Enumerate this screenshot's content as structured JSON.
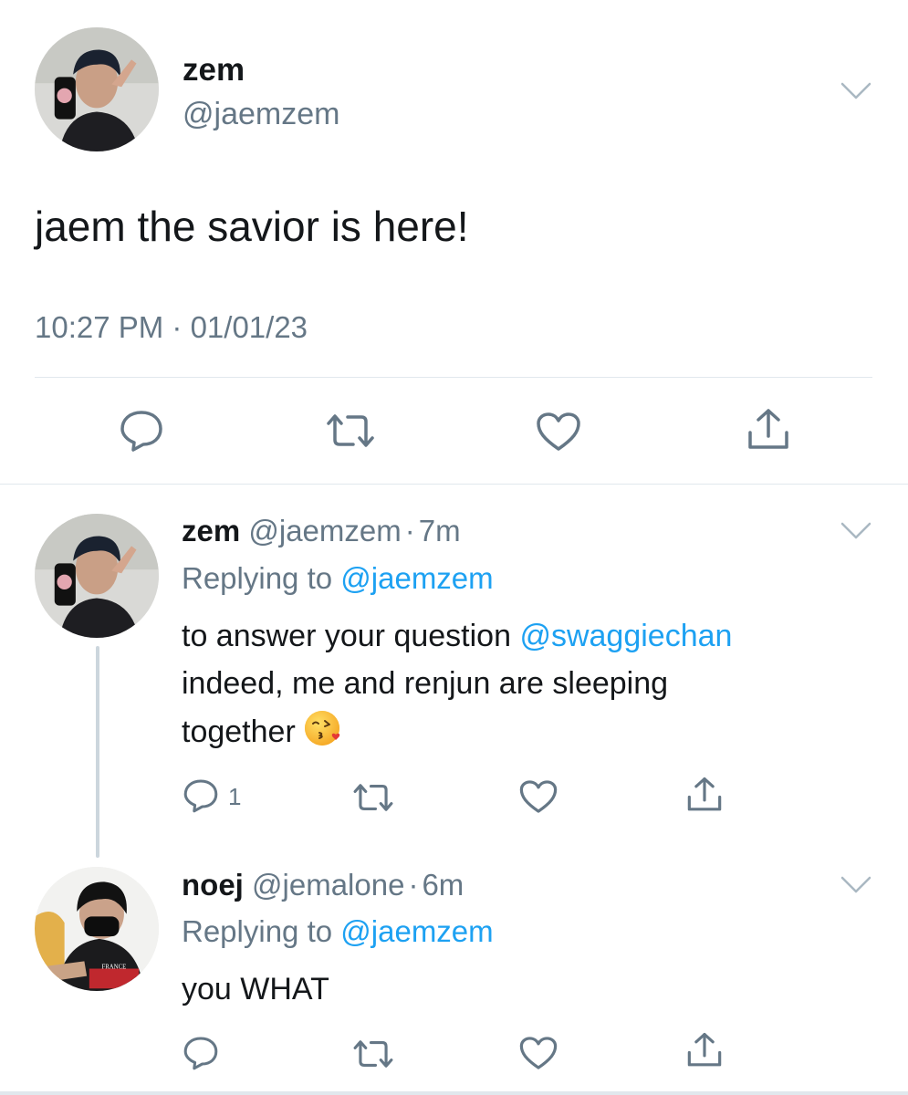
{
  "main_tweet": {
    "author_name": "zem",
    "author_handle": "@jaemzem",
    "text": "jaem the savior is here!",
    "timestamp": "10:27 PM · 01/01/23",
    "actions": [
      "reply-icon",
      "retweet-icon",
      "like-icon",
      "share-icon"
    ]
  },
  "replies": [
    {
      "author_name": "zem",
      "author_handle": "@jaemzem",
      "time_sep": "·",
      "age": "7m",
      "replying_prefix": "Replying to",
      "replying_to": "@jaemzem",
      "text_part1": "to answer your question",
      "mention": "@swaggiechan",
      "text_part2": "indeed, me and renjun are sleeping",
      "text_part3": "together",
      "emoji": "face-blowing-kiss-emoji",
      "reply_count": "1"
    },
    {
      "author_name": "noej",
      "author_handle": "@jemalone",
      "time_sep": "·",
      "age": "6m",
      "replying_prefix": "Replying to",
      "replying_to": "@jaemzem",
      "text": "you WHAT"
    }
  ],
  "colors": {
    "text": "#14171a",
    "secondary": "#657786",
    "link": "#1da1f2",
    "divider": "#e1e8ed"
  }
}
